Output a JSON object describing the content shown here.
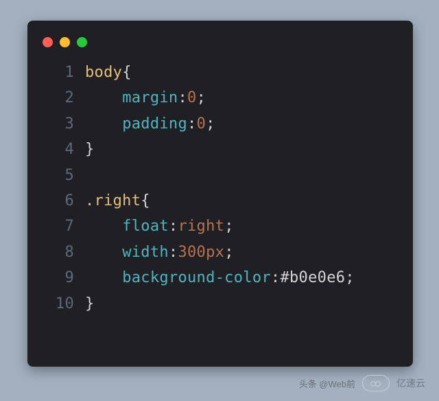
{
  "editor": {
    "trafficLights": [
      "close",
      "minimize",
      "zoom"
    ],
    "lines": [
      {
        "num": 1,
        "tokens": [
          {
            "t": "body",
            "c": "c-sel"
          },
          {
            "t": "{",
            "c": "c-punc"
          }
        ]
      },
      {
        "num": 2,
        "tokens": [
          {
            "t": "    ",
            "c": ""
          },
          {
            "t": "margin",
            "c": "c-prop"
          },
          {
            "t": ":",
            "c": "c-punc"
          },
          {
            "t": "0",
            "c": "c-num"
          },
          {
            "t": ";",
            "c": "c-punc"
          }
        ]
      },
      {
        "num": 3,
        "tokens": [
          {
            "t": "    ",
            "c": ""
          },
          {
            "t": "padding",
            "c": "c-prop"
          },
          {
            "t": ":",
            "c": "c-punc"
          },
          {
            "t": "0",
            "c": "c-num"
          },
          {
            "t": ";",
            "c": "c-punc"
          }
        ]
      },
      {
        "num": 4,
        "tokens": [
          {
            "t": "}",
            "c": "c-punc"
          }
        ]
      },
      {
        "num": 5,
        "tokens": [
          {
            "t": "",
            "c": ""
          }
        ]
      },
      {
        "num": 6,
        "tokens": [
          {
            "t": ".right",
            "c": "c-sel"
          },
          {
            "t": "{",
            "c": "c-punc"
          }
        ]
      },
      {
        "num": 7,
        "tokens": [
          {
            "t": "    ",
            "c": ""
          },
          {
            "t": "float",
            "c": "c-prop"
          },
          {
            "t": ":",
            "c": "c-punc"
          },
          {
            "t": "right",
            "c": "c-val"
          },
          {
            "t": ";",
            "c": "c-punc"
          }
        ]
      },
      {
        "num": 8,
        "tokens": [
          {
            "t": "    ",
            "c": ""
          },
          {
            "t": "width",
            "c": "c-prop"
          },
          {
            "t": ":",
            "c": "c-punc"
          },
          {
            "t": "300px",
            "c": "c-num"
          },
          {
            "t": ";",
            "c": "c-punc"
          }
        ]
      },
      {
        "num": 9,
        "tokens": [
          {
            "t": "    ",
            "c": ""
          },
          {
            "t": "background-color",
            "c": "c-prop"
          },
          {
            "t": ":",
            "c": "c-punc"
          },
          {
            "t": "#b0e0e6",
            "c": "c-hex"
          },
          {
            "t": ";",
            "c": "c-punc"
          }
        ]
      },
      {
        "num": 10,
        "tokens": [
          {
            "t": "}",
            "c": "c-punc"
          }
        ]
      }
    ]
  },
  "watermark": {
    "source": "头条 @Web前",
    "brand": "亿速云"
  }
}
